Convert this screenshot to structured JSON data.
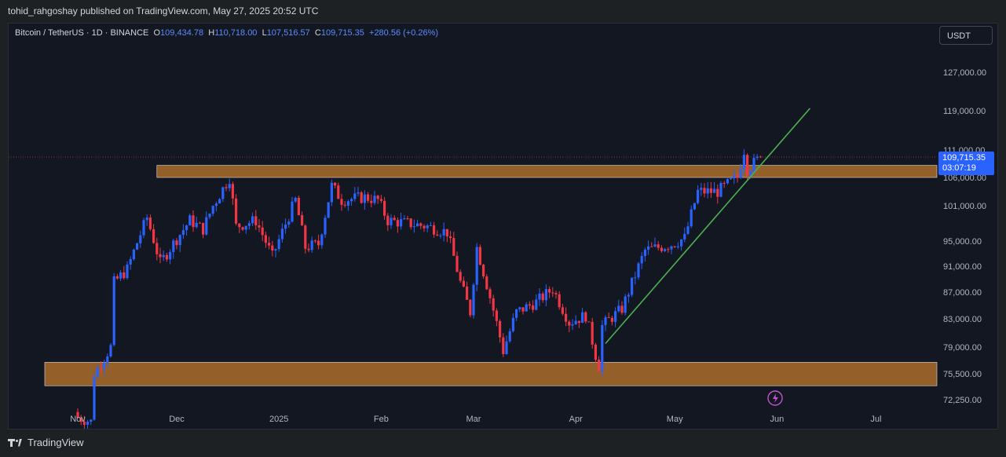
{
  "header": {
    "publisher_line": "tohid_rahgoshay published on TradingView.com, May 27, 2025 20:52 UTC"
  },
  "legend": {
    "symbol": "Bitcoin / TetherUS · 1D · BINANCE",
    "o_label": "O",
    "o_value": "109,434.78",
    "h_label": "H",
    "h_value": "110,718.00",
    "l_label": "L",
    "l_value": "107,516.57",
    "c_label": "C",
    "c_value": "109,715.35",
    "change": "+280.56 (+0.26%)"
  },
  "currency_button": "USDT",
  "last_price": {
    "price": "109,715.35",
    "countdown": "03:07:19"
  },
  "footer": {
    "brand": "TradingView"
  },
  "colors": {
    "up": "#2962ff",
    "down": "#f23645",
    "zone": "#b8732a",
    "trendline": "#4caf50",
    "background": "#131722"
  },
  "chart_data": {
    "type": "candlestick",
    "symbol": "BTCUSDT",
    "timeframe": "1D",
    "y_ticks": [
      127000,
      119000,
      111000,
      106000,
      101000,
      95000,
      91000,
      87000,
      83000,
      79000,
      75500,
      72250
    ],
    "y_tick_labels": [
      "127,000.00",
      "119,000.00",
      "111,000.00",
      "106,000.00",
      "101,000.00",
      "95,000.00",
      "91,000.00",
      "87,000.00",
      "83,000.00",
      "79,000.00",
      "75,500.00",
      "72,250.00"
    ],
    "x_ticks": [
      "Nov",
      "Dec",
      "2025",
      "Feb",
      "Mar",
      "Apr",
      "May",
      "Jun",
      "Jul"
    ],
    "close_path": [
      {
        "date": "2024-11-01",
        "close": 70000
      },
      {
        "date": "2024-11-05",
        "close": 69500
      },
      {
        "date": "2024-11-06",
        "close": 75500
      },
      {
        "date": "2024-11-11",
        "close": 79000
      },
      {
        "date": "2024-11-12",
        "close": 88500
      },
      {
        "date": "2024-11-16",
        "close": 90500
      },
      {
        "date": "2024-11-22",
        "close": 99000
      },
      {
        "date": "2024-11-26",
        "close": 91500
      },
      {
        "date": "2024-12-05",
        "close": 98500
      },
      {
        "date": "2024-12-09",
        "close": 97000
      },
      {
        "date": "2024-12-12",
        "close": 101000
      },
      {
        "date": "2024-12-17",
        "close": 106000
      },
      {
        "date": "2024-12-19",
        "close": 97500
      },
      {
        "date": "2024-12-25",
        "close": 98500
      },
      {
        "date": "2024-12-30",
        "close": 92500
      },
      {
        "date": "2025-01-06",
        "close": 102000
      },
      {
        "date": "2025-01-09",
        "close": 94000
      },
      {
        "date": "2025-01-13",
        "close": 94500
      },
      {
        "date": "2025-01-17",
        "close": 104500
      },
      {
        "date": "2025-01-20",
        "close": 102000
      },
      {
        "date": "2025-01-27",
        "close": 102500
      },
      {
        "date": "2025-01-31",
        "close": 102000
      },
      {
        "date": "2025-02-03",
        "close": 98500
      },
      {
        "date": "2025-02-15",
        "close": 97500
      },
      {
        "date": "2025-02-21",
        "close": 96500
      },
      {
        "date": "2025-02-25",
        "close": 88500
      },
      {
        "date": "2025-02-28",
        "close": 84000
      },
      {
        "date": "2025-03-02",
        "close": 94000
      },
      {
        "date": "2025-03-10",
        "close": 78500
      },
      {
        "date": "2025-03-14",
        "close": 84000
      },
      {
        "date": "2025-03-20",
        "close": 85500
      },
      {
        "date": "2025-03-25",
        "close": 87500
      },
      {
        "date": "2025-03-30",
        "close": 82500
      },
      {
        "date": "2025-04-04",
        "close": 83500
      },
      {
        "date": "2025-04-07",
        "close": 78000
      },
      {
        "date": "2025-04-08",
        "close": 76500
      },
      {
        "date": "2025-04-09",
        "close": 82000
      },
      {
        "date": "2025-04-15",
        "close": 84500
      },
      {
        "date": "2025-04-22",
        "close": 93500
      },
      {
        "date": "2025-04-30",
        "close": 94500
      },
      {
        "date": "2025-05-04",
        "close": 95500
      },
      {
        "date": "2025-05-08",
        "close": 103500
      },
      {
        "date": "2025-05-14",
        "close": 103500
      },
      {
        "date": "2025-05-20",
        "close": 106000
      },
      {
        "date": "2025-05-22",
        "close": 111000
      },
      {
        "date": "2025-05-23",
        "close": 107500
      },
      {
        "date": "2025-05-27",
        "close": 109715.35
      }
    ],
    "zones": [
      {
        "name": "resistance",
        "start": "2024-11-25",
        "top": 108200,
        "bottom": 106000
      },
      {
        "name": "support",
        "start": "2024-10-22",
        "top": 77000,
        "bottom": 74000
      }
    ],
    "trendline": {
      "start": {
        "date": "2025-04-10",
        "price": 79500
      },
      "end": {
        "date": "2025-06-11",
        "price": 119500
      }
    },
    "last_price": 109715.35,
    "currency": "USDT"
  }
}
